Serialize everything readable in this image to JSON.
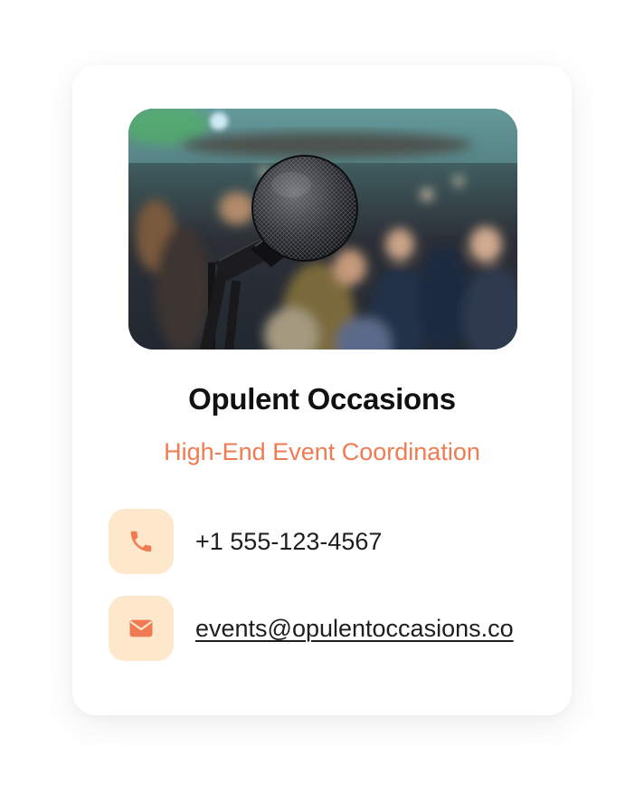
{
  "card": {
    "business_name": "Opulent Occasions",
    "tagline": "High-End Event Coordination",
    "photo_subject": "microphone-on-stand-event-venue"
  },
  "contacts": {
    "phone": {
      "icon": "phone-icon",
      "value": "+1 555-123-4567"
    },
    "email": {
      "icon": "envelope-icon",
      "value": "events@opulentoccasions.co"
    }
  },
  "colors": {
    "accent": "#f07b52",
    "icon_background": "#fde8cc",
    "title": "#111111",
    "text": "#1e1e1e",
    "card_background": "#ffffff"
  }
}
